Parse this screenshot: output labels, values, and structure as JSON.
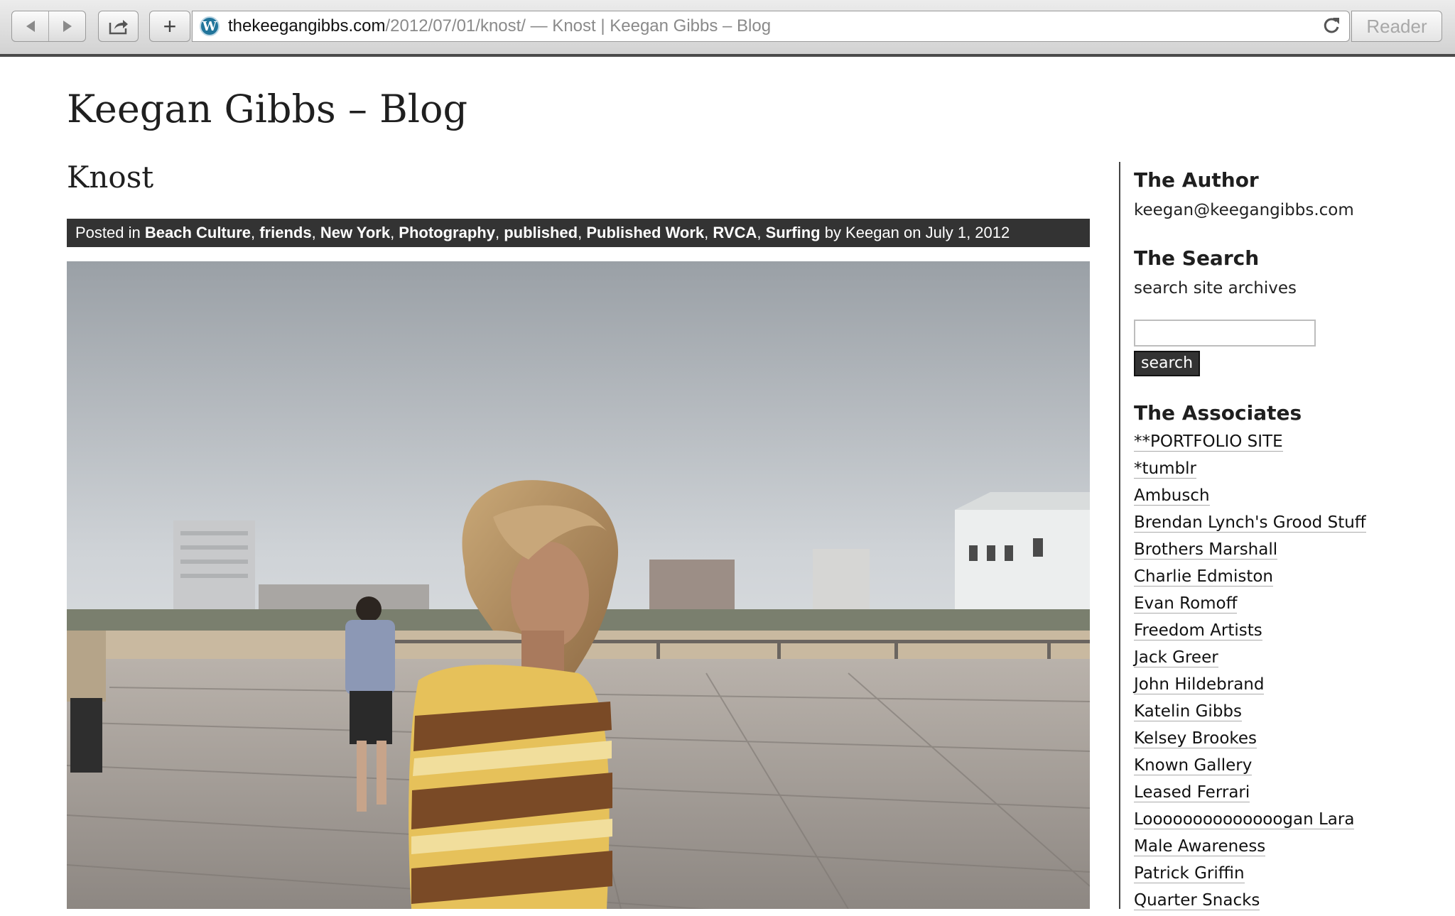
{
  "browser": {
    "url_host": "thekeegangibbs.com",
    "url_path": "/2012/07/01/knost/",
    "page_title": " — Knost | Keegan Gibbs – Blog",
    "reader_label": "Reader",
    "new_tab_glyph": "+"
  },
  "site": {
    "title": "Keegan Gibbs – Blog"
  },
  "post": {
    "title": "Knost",
    "meta_prefix": "Posted in ",
    "categories": [
      "Beach Culture",
      "friends",
      "New York",
      "Photography",
      "published",
      "Published Work",
      "RVCA",
      "Surfing"
    ],
    "meta_by": " by Keegan on July 1, 2012"
  },
  "sidebar": {
    "author": {
      "title": "The Author",
      "email": "keegan@keegangibbs.com"
    },
    "search": {
      "title": "The Search",
      "description": "search site archives",
      "button_label": "search"
    },
    "associates": {
      "title": "The Associates",
      "links": [
        "**PORTFOLIO SITE",
        "*tumblr",
        "Ambusch",
        "Brendan Lynch's Grood Stuff",
        "Brothers Marshall",
        "Charlie Edmiston",
        "Evan Romoff",
        "Freedom Artists",
        "Jack Greer",
        "John Hildebrand",
        "Katelin Gibbs",
        "Kelsey Brookes",
        "Known Gallery",
        "Leased Ferrari",
        "Loooooooooooooogan Lara",
        "Male Awareness",
        "Patrick Griffin",
        "Quarter Snacks"
      ]
    }
  }
}
